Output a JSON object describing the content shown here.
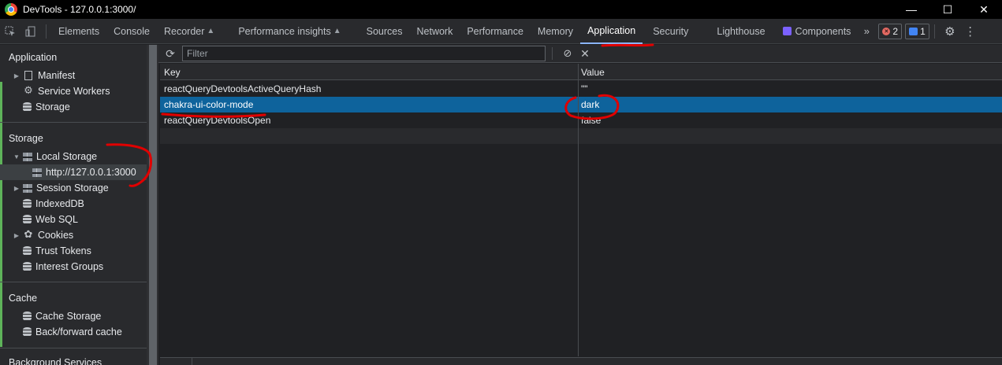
{
  "window": {
    "title": "DevTools - 127.0.0.1:3000/",
    "minimize": "—",
    "maximize": "☐",
    "close": "✕"
  },
  "tabs": [
    {
      "label": "Elements"
    },
    {
      "label": "Console"
    },
    {
      "label": "Recorder",
      "flask": "▲"
    },
    {
      "label": "Performance insights",
      "flask": "▲"
    },
    {
      "label": "Sources"
    },
    {
      "label": "Network"
    },
    {
      "label": "Performance"
    },
    {
      "label": "Memory"
    },
    {
      "label": "Application",
      "active": true
    },
    {
      "label": "Security"
    },
    {
      "label": "Lighthouse"
    },
    {
      "label": "Components"
    }
  ],
  "tab_more": "»",
  "badges": {
    "errors": "2",
    "messages": "1"
  },
  "sidebar": {
    "application_head": "Application",
    "application_items": [
      "Manifest",
      "Service Workers",
      "Storage"
    ],
    "storage_head": "Storage",
    "local_storage": "Local Storage",
    "local_storage_origin": "http://127.0.0.1:3000",
    "session_storage": "Session Storage",
    "storage_items": [
      "IndexedDB",
      "Web SQL",
      "Cookies",
      "Trust Tokens",
      "Interest Groups"
    ],
    "cache_head": "Cache",
    "cache_items": [
      "Cache Storage",
      "Back/forward cache"
    ],
    "background_head": "Background Services"
  },
  "toolbar": {
    "filter_placeholder": "Filter",
    "filter_value": ""
  },
  "table": {
    "columns": [
      "Key",
      "Value"
    ],
    "rows": [
      {
        "key": "reactQueryDevtoolsActiveQueryHash",
        "value": "\"\""
      },
      {
        "key": "chakra-ui-color-mode",
        "value": "dark",
        "selected": true
      },
      {
        "key": "reactQueryDevtoolsOpen",
        "value": "false"
      }
    ]
  },
  "colors": {
    "accent": "#8ab4f8",
    "selection": "#0e639c",
    "annotation": "#e00000",
    "storage_green": "#5eb35a"
  }
}
